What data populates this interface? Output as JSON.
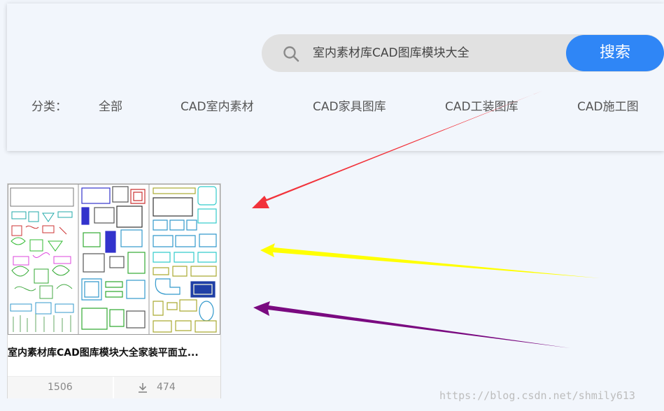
{
  "search": {
    "query": "室内素材库CAD图库模块大全",
    "button_label": "搜索"
  },
  "categories": {
    "label": "分类：",
    "items": [
      "全部",
      "CAD室内素材",
      "CAD家具图库",
      "CAD工装图库",
      "CAD施工图"
    ]
  },
  "card": {
    "title": "室内素材库CAD图库模块大全家装平面立...",
    "views": "1506",
    "downloads": "474"
  },
  "watermark": "https://blog.csdn.net/shmily613",
  "colors": {
    "search_button": "#2f86f6",
    "arrow_red": "#f2333b",
    "arrow_yellow": "#ffff00",
    "arrow_purple": "#7a0a80"
  }
}
